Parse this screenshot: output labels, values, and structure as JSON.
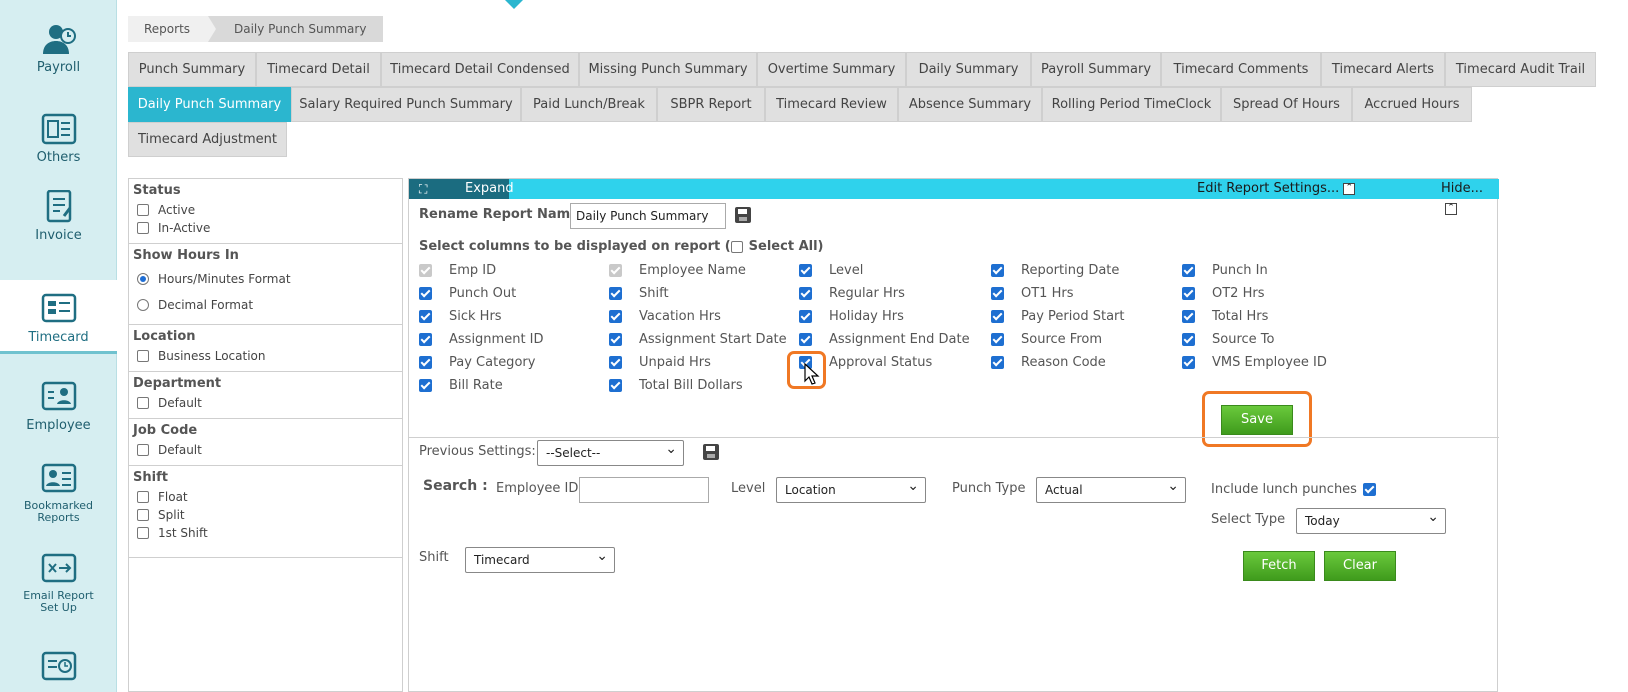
{
  "sidebar": {
    "items": [
      {
        "label": "Payroll",
        "icon": "payroll-icon"
      },
      {
        "label": "Others",
        "icon": "others-icon"
      },
      {
        "label": "Invoice",
        "icon": "invoice-icon"
      },
      {
        "label": "Timecard",
        "icon": "timecard-icon",
        "active": true
      },
      {
        "label": "Employee",
        "icon": "employee-icon"
      },
      {
        "label": "Bookmarked Reports",
        "icon": "bookmarked-reports-icon"
      },
      {
        "label": "Email Report Set Up",
        "icon": "email-report-icon"
      },
      {
        "label": "",
        "icon": "schedule-icon"
      }
    ]
  },
  "breadcrumb": {
    "root": "Reports",
    "current": "Daily Punch Summary"
  },
  "tabs": {
    "row1": [
      "Punch Summary",
      "Timecard Detail",
      "Timecard Detail Condensed",
      "Missing Punch Summary",
      "Overtime Summary",
      "Daily Summary",
      "Payroll Summary",
      "Timecard Comments",
      "Timecard Alerts",
      "Timecard Audit Trail"
    ],
    "row2": [
      "Daily Punch Summary",
      "Salary Required Punch Summary",
      "Paid Lunch/Break",
      "SBPR Report",
      "Timecard Review",
      "Absence Summary",
      "Rolling Period TimeClock",
      "Spread Of Hours",
      "Accrued Hours"
    ],
    "row3": [
      "Timecard Adjustment"
    ],
    "active": "Daily Punch Summary"
  },
  "filters": {
    "status": {
      "title": "Status",
      "options": [
        "Active",
        "In-Active"
      ]
    },
    "show_hours": {
      "title": "Show Hours In",
      "options": [
        "Hours/Minutes Format",
        "Decimal Format"
      ],
      "selected": "Hours/Minutes Format"
    },
    "location": {
      "title": "Location",
      "options": [
        "Business Location"
      ]
    },
    "department": {
      "title": "Department",
      "options": [
        "Default"
      ]
    },
    "job_code": {
      "title": "Job Code",
      "options": [
        "Default"
      ]
    },
    "shift": {
      "title": "Shift",
      "options": [
        "Float",
        "Split",
        "1st Shift"
      ]
    }
  },
  "panel": {
    "expand_label": "Expand",
    "edit_settings": "Edit Report Settings...",
    "hide": "Hide...",
    "rename_label": "Rename Report Name:",
    "rename_value": "Daily Punch Summary",
    "select_columns_label": "Select columns to be displayed on report (",
    "select_all": "Select All)",
    "columns": [
      [
        "Emp ID",
        "Employee Name",
        "Level",
        "Reporting Date",
        "Punch In"
      ],
      [
        "Punch Out",
        "Shift",
        "Regular Hrs",
        "OT1 Hrs",
        "OT2 Hrs"
      ],
      [
        "Sick Hrs",
        "Vacation Hrs",
        "Holiday Hrs",
        "Pay Period Start",
        "Total Hrs"
      ],
      [
        "Assignment ID",
        "Assignment Start Date",
        "Assignment End Date",
        "Source From",
        "Source To"
      ],
      [
        "Pay Category",
        "Unpaid Hrs",
        "Approval Status",
        "Reason Code",
        "VMS Employee ID"
      ],
      [
        "Bill Rate",
        "Total Bill Dollars"
      ]
    ],
    "save": "Save",
    "previous_settings_label": "Previous Settings:",
    "previous_settings_value": "--Select--",
    "search_label": "Search :",
    "employee_id_label": "Employee ID",
    "employee_id_value": "",
    "level_label": "Level",
    "level_value": "Location",
    "punch_type_label": "Punch Type",
    "punch_type_value": "Actual",
    "include_lunch": "Include lunch punches",
    "select_type_label": "Select Type",
    "select_type_value": "Today",
    "shift_label": "Shift",
    "shift_value": "Timecard",
    "fetch": "Fetch",
    "clear": "Clear"
  },
  "colors": {
    "accent": "#2bb6cf",
    "bar": "#2fd2ec",
    "green": "#4caf2a",
    "highlight": "#f07824"
  }
}
